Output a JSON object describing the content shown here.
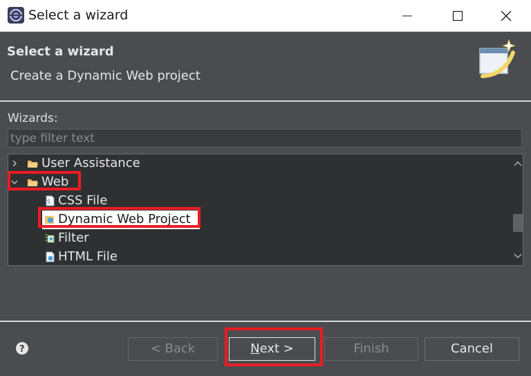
{
  "window": {
    "title": "Select a wizard",
    "controls": [
      "minimize-icon",
      "maximize-icon",
      "close-icon"
    ]
  },
  "banner": {
    "title": "Select a wizard",
    "description": "Create a Dynamic Web project"
  },
  "filter": {
    "label": "Wizards:",
    "placeholder": "type filter text",
    "value": ""
  },
  "tree": {
    "items": [
      {
        "label": "User Assistance",
        "level": 0,
        "expanded": false,
        "icon": "folder-icon"
      },
      {
        "label": "Web",
        "level": 0,
        "expanded": true,
        "icon": "folder-icon"
      },
      {
        "label": "CSS File",
        "level": 1,
        "icon": "css-file-icon"
      },
      {
        "label": "Dynamic Web Project",
        "level": 1,
        "icon": "web-project-icon",
        "selected": true
      },
      {
        "label": "Filter",
        "level": 1,
        "icon": "filter-icon"
      },
      {
        "label": "HTML File",
        "level": 1,
        "icon": "html-file-icon"
      }
    ]
  },
  "buttons": {
    "back": "< Back",
    "next_mnemonic": "N",
    "next_rest": "ext >",
    "finish": "Finish",
    "cancel": "Cancel"
  },
  "colors": {
    "background": "#4a4c4f",
    "tree_background": "#2f3032",
    "selection": "#ffffff",
    "annotation": "#ec1c24"
  }
}
